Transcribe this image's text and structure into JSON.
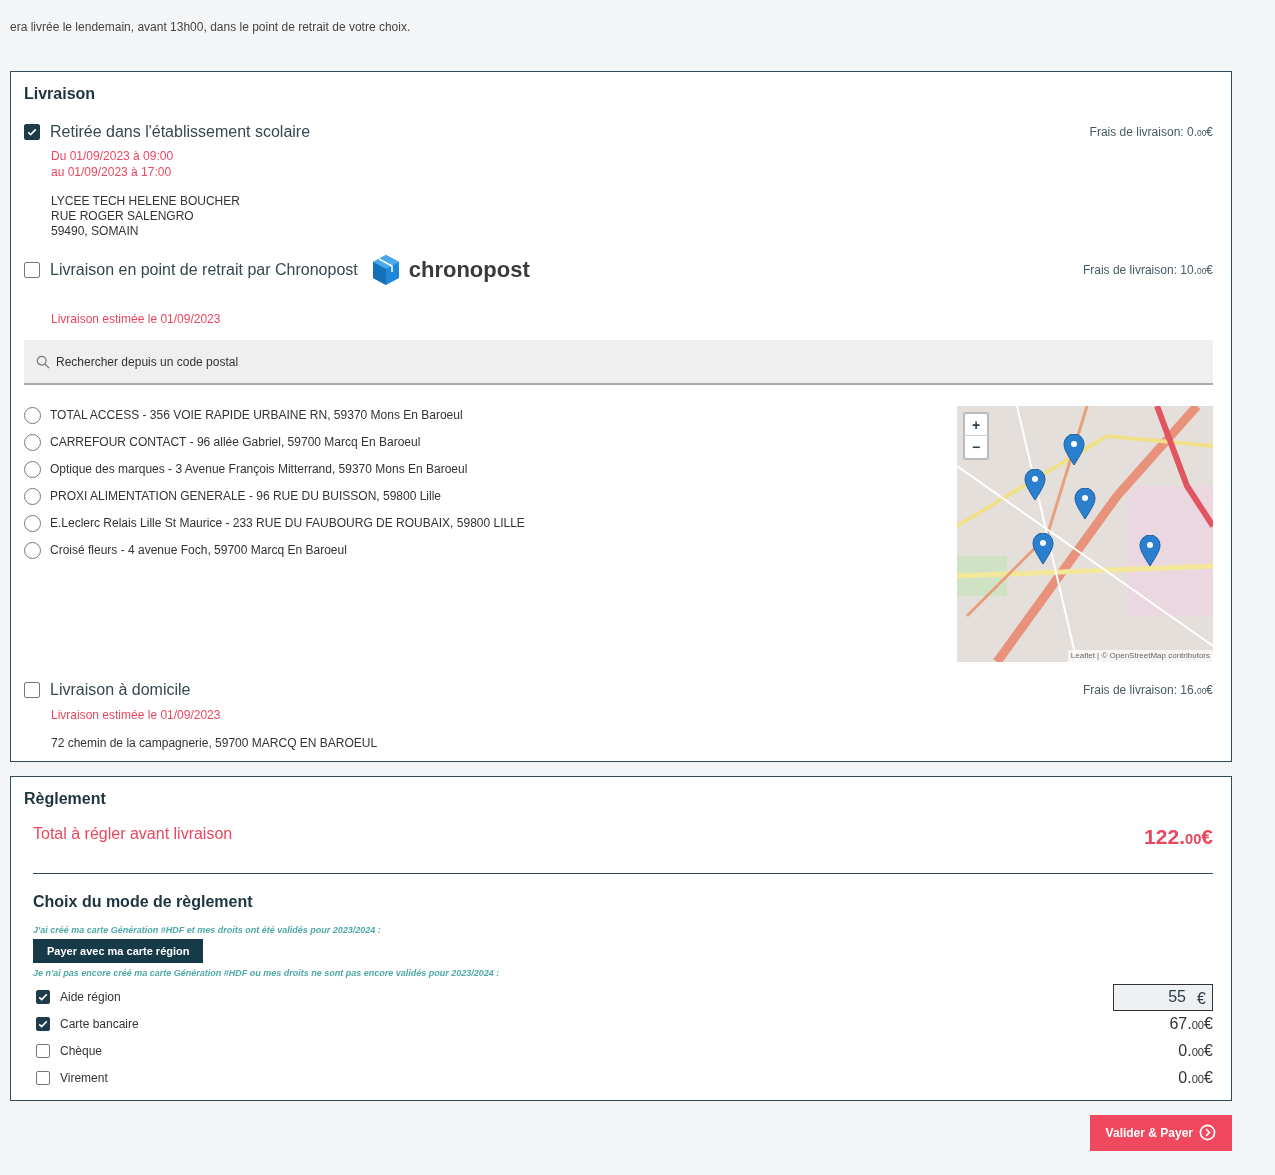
{
  "intro": "era livrée le lendemain, avant 13h00, dans le point de retrait de votre choix.",
  "delivery": {
    "title": "Livraison",
    "options": [
      {
        "kind": "school",
        "label": "Retirée dans l'établissement scolaire",
        "checked": true,
        "fee_label": "Frais de livraison:",
        "fee_units": "0.",
        "fee_cents": "00",
        "currency": "€",
        "dates": [
          "Du 01/09/2023 à 09:00",
          "au 01/09/2023 à 17:00"
        ],
        "address": [
          "LYCEE TECH HELENE BOUCHER",
          "RUE ROGER SALENGRO",
          "59490, SOMAIN"
        ]
      },
      {
        "kind": "relay",
        "label": "Livraison en point de retrait par Chronopost",
        "logo": "chronopost",
        "checked": false,
        "fee_label": "Frais de livraison:",
        "fee_units": "10.",
        "fee_cents": "00",
        "currency": "€",
        "estimate": "Livraison estimée le 01/09/2023",
        "search": {
          "placeholder": "Rechercher depuis un code postal"
        },
        "points": [
          {
            "label": "TOTAL ACCESS - 356 VOIE RAPIDE URBAINE RN, 59370 Mons En Baroeul",
            "selected": false
          },
          {
            "label": "CARREFOUR CONTACT - 96 allée Gabriel, 59700 Marcq En Baroeul",
            "selected": false
          },
          {
            "label": "Optique des marques - 3 Avenue François Mitterrand, 59370 Mons En Baroeul",
            "selected": false
          },
          {
            "label": "PROXI ALIMENTATION GENERALE - 96 RUE DU BUISSON, 59800 Lille",
            "selected": false
          },
          {
            "label": "E.Leclerc Relais Lille St Maurice - 233 RUE DU FAUBOURG DE ROUBAIX, 59800 LILLE",
            "selected": false
          },
          {
            "label": "Croisé fleurs - 4 avenue Foch, 59700 Marcq En Baroeul",
            "selected": false
          }
        ],
        "map": {
          "zoom_in": "+",
          "zoom_out": "−",
          "attribution": "Leaflet | © OpenStreetMap contributors"
        }
      },
      {
        "kind": "home",
        "label": "Livraison à domicile",
        "checked": false,
        "fee_label": "Frais de livraison:",
        "fee_units": "16.",
        "fee_cents": "00",
        "currency": "€",
        "estimate": "Livraison estimée le 01/09/2023",
        "address": [
          "72 chemin de la campagnerie, 59700 MARCQ EN BAROEUL"
        ]
      }
    ]
  },
  "payment": {
    "title": "Règlement",
    "total_label": "Total à régler avant livraison",
    "total_units": "122.",
    "total_cents": "00",
    "total_currency": "€",
    "mode_title": "Choix du mode de règlement",
    "card_note": "J'ai créé ma carte Génération #HDF et mes droits ont été validés pour 2023/2024 :",
    "card_button": "Payer avec ma carte région",
    "other_note": "Je n'ai pas encore créé ma carte Génération #HDF ou mes droits ne sont pas encore validés pour 2023/2024 :",
    "methods": [
      {
        "kind": "input",
        "label": "Aide région",
        "checked": true,
        "value": "55",
        "currency": "€"
      },
      {
        "kind": "amount",
        "label": "Carte bancaire",
        "checked": true,
        "units": "67.",
        "cents": "00",
        "currency": "€"
      },
      {
        "kind": "amount",
        "label": "Chèque",
        "checked": false,
        "units": "0.",
        "cents": "00",
        "currency": "€"
      },
      {
        "kind": "amount",
        "label": "Virement",
        "checked": false,
        "units": "0.",
        "cents": "00",
        "currency": "€"
      }
    ]
  },
  "submit": "Valider & Payer"
}
